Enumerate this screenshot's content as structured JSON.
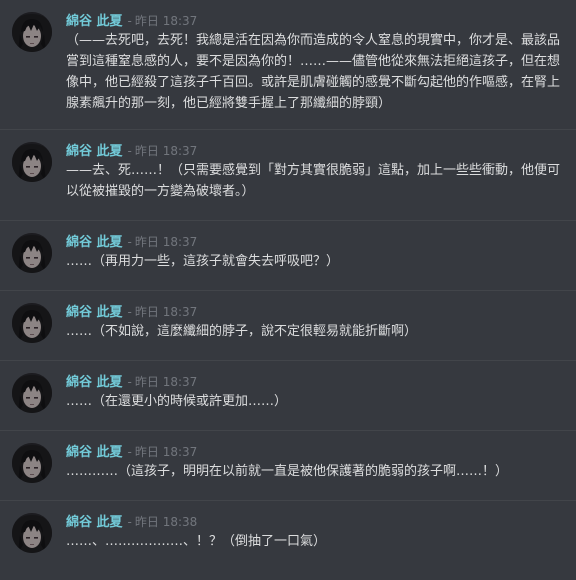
{
  "messages": [
    {
      "author": "綿谷 此夏",
      "separator": "-",
      "timestamp": "昨日 18:37",
      "text": "（——去死吧，去死！我總是活在因為你而造成的令人窒息的現實中，你才是、最該品嘗到這種窒息感的人，要不是因為你的！……——儘管他從來無法拒絕這孩子，但在想像中，他已經殺了這孩子千百回。或許是肌膚碰觸的感覺不斷勾起他的作嘔感，在腎上腺素飆升的那一刻，他已經將雙手握上了那纖細的脖頸）"
    },
    {
      "author": "綿谷 此夏",
      "separator": "-",
      "timestamp": "昨日 18:37",
      "text": "——去、死……！（只需要感覺到「對方其實很脆弱」這點，加上一些些衝動，他便可以從被摧毀的一方變為破壞者。）"
    },
    {
      "author": "綿谷 此夏",
      "separator": "-",
      "timestamp": "昨日 18:37",
      "text": "……（再用力一些，這孩子就會失去呼吸吧？）"
    },
    {
      "author": "綿谷 此夏",
      "separator": "-",
      "timestamp": "昨日 18:37",
      "text": "……（不如說，這麼纖細的脖子，說不定很輕易就能折斷啊）"
    },
    {
      "author": "綿谷 此夏",
      "separator": "-",
      "timestamp": "昨日 18:37",
      "text": "……（在還更小的時候或許更加……）"
    },
    {
      "author": "綿谷 此夏",
      "separator": "-",
      "timestamp": "昨日 18:37",
      "text": "…………（這孩子，明明在以前就一直是被他保護著的脆弱的孩子啊……！）"
    },
    {
      "author": "綿谷 此夏",
      "separator": "-",
      "timestamp": "昨日 18:38",
      "text": "……、………………、！？（倒抽了一口氣）"
    }
  ],
  "colors": {
    "background": "#36393f",
    "author": "#72cad8",
    "timestamp": "#72767d",
    "text": "#dcddde",
    "divider": "#42454a"
  },
  "icons": {
    "avatar": "user-avatar-icon"
  }
}
